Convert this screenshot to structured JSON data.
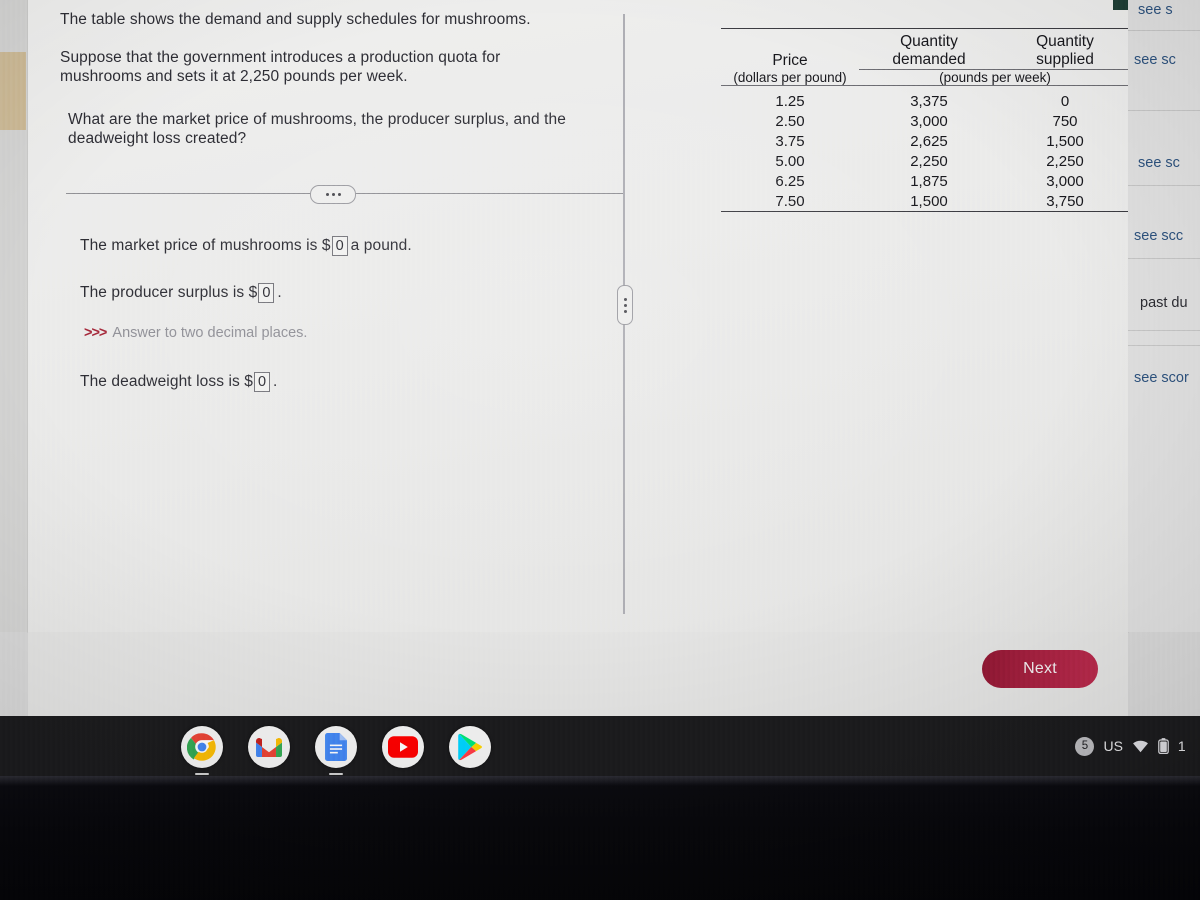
{
  "question": {
    "intro": "The table shows the demand and supply schedules for mushrooms.",
    "scenario": "Suppose that the government introduces a production quota for mushrooms and sets it at 2,250 pounds per week.",
    "prompt": "What are the market price of mushrooms, the producer  surplus, and the deadweight loss created?",
    "expander_label": "..."
  },
  "answers": {
    "market_price": {
      "prefix": "The market price of mushrooms is $",
      "value": "0",
      "suffix": " a pound."
    },
    "producer_surplus": {
      "prefix": "The producer surplus is $",
      "value": "0",
      "suffix": "."
    },
    "hint": {
      "arrows": ">>>",
      "text": "Answer to two decimal places."
    },
    "deadweight_loss": {
      "prefix": "The deadweight loss is $",
      "value": "0",
      "suffix": "."
    }
  },
  "table": {
    "headers": {
      "price": "Price",
      "price_units": "(dollars per pound)",
      "qty_demanded_l1": "Quantity",
      "qty_demanded_l2": "demanded",
      "qty_supplied_l1": "Quantity",
      "qty_supplied_l2": "supplied",
      "qty_units": "(pounds per week)"
    },
    "rows": [
      {
        "price": "1.25",
        "demanded": "3,375",
        "supplied": "0"
      },
      {
        "price": "2.50",
        "demanded": "3,000",
        "supplied": "750"
      },
      {
        "price": "3.75",
        "demanded": "2,625",
        "supplied": "1,500"
      },
      {
        "price": "5.00",
        "demanded": "2,250",
        "supplied": "2,250"
      },
      {
        "price": "6.25",
        "demanded": "1,875",
        "supplied": "3,000"
      },
      {
        "price": "7.50",
        "demanded": "1,500",
        "supplied": "3,750"
      }
    ]
  },
  "side_panel": {
    "rows": [
      {
        "label": "see s",
        "type": "link"
      },
      {
        "label": "see sc",
        "type": "link"
      },
      {
        "label": "see sc",
        "type": "link"
      },
      {
        "label": "see scc",
        "type": "link"
      },
      {
        "label": "past du",
        "type": "text"
      },
      {
        "label": "see scor",
        "type": "link"
      }
    ]
  },
  "footer": {
    "next_label": "Next"
  },
  "shelf": {
    "apps": [
      {
        "name": "chrome",
        "label": "Chrome"
      },
      {
        "name": "gmail",
        "label": "Gmail"
      },
      {
        "name": "docs",
        "label": "Docs"
      },
      {
        "name": "youtube",
        "label": "YouTube"
      },
      {
        "name": "play-store",
        "label": "Play Store"
      }
    ],
    "tray": {
      "notification_count": "5",
      "locale": "US",
      "clock": "1"
    }
  },
  "colors": {
    "accent_next": "#a5203f",
    "hint_arrow": "#a32638",
    "link": "#2b4f7a",
    "shelf_bg": "#1b1b1d",
    "top_chrome": "#1d3d34"
  }
}
